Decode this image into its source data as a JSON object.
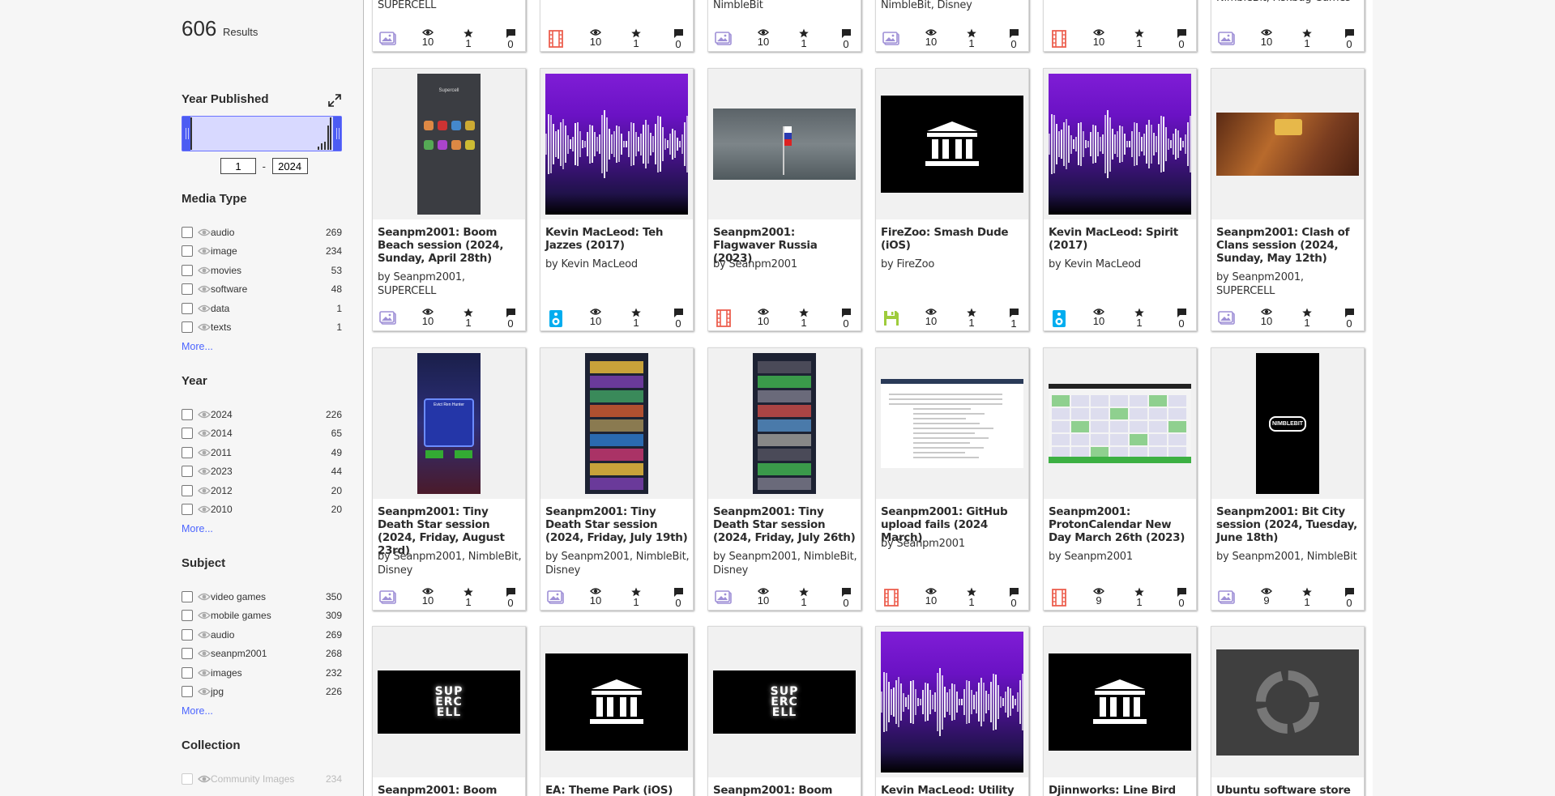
{
  "results": {
    "count": "606",
    "label": "Results"
  },
  "facets": {
    "year_published": {
      "title": "Year Published",
      "from": "1",
      "to": "2024"
    },
    "media_type": {
      "title": "Media Type",
      "items": [
        {
          "label": "audio",
          "count": "269"
        },
        {
          "label": "image",
          "count": "234"
        },
        {
          "label": "movies",
          "count": "53"
        },
        {
          "label": "software",
          "count": "48"
        },
        {
          "label": "data",
          "count": "1"
        },
        {
          "label": "texts",
          "count": "1"
        }
      ],
      "more": "More..."
    },
    "year": {
      "title": "Year",
      "items": [
        {
          "label": "2024",
          "count": "226"
        },
        {
          "label": "2014",
          "count": "65"
        },
        {
          "label": "2011",
          "count": "49"
        },
        {
          "label": "2023",
          "count": "44"
        },
        {
          "label": "2012",
          "count": "20"
        },
        {
          "label": "2010",
          "count": "20"
        }
      ],
      "more": "More..."
    },
    "subject": {
      "title": "Subject",
      "items": [
        {
          "label": "video games",
          "count": "350"
        },
        {
          "label": "mobile games",
          "count": "309"
        },
        {
          "label": "audio",
          "count": "269"
        },
        {
          "label": "seanpm2001",
          "count": "268"
        },
        {
          "label": "images",
          "count": "232"
        },
        {
          "label": "jpg",
          "count": "226"
        }
      ],
      "more": "More..."
    },
    "collection": {
      "title": "Collection",
      "items": [
        {
          "label": "Community Images",
          "count": "234"
        }
      ]
    }
  },
  "top_row": [
    {
      "by": "SUPERCELL",
      "media": "image",
      "views": "10",
      "favs": "1",
      "comments": "0"
    },
    {
      "by": "",
      "media": "movies",
      "views": "10",
      "favs": "1",
      "comments": "0"
    },
    {
      "by": "NimbleBit",
      "media": "image",
      "views": "10",
      "favs": "1",
      "comments": "0"
    },
    {
      "by": "NimbleBit, Disney",
      "media": "image",
      "views": "10",
      "favs": "1",
      "comments": "0"
    },
    {
      "by": "",
      "media": "movies",
      "views": "10",
      "favs": "1",
      "comments": "0"
    },
    {
      "by": "NimbleBit, Fiskbug Games",
      "media": "image",
      "views": "10",
      "favs": "1",
      "comments": "0"
    }
  ],
  "row1": [
    {
      "title": "Seanpm2001: Boom Beach session (2024, Sunday, April 28th)",
      "by": "by Seanpm2001, SUPERCELL",
      "media": "image",
      "views": "10",
      "favs": "1",
      "comments": "0",
      "thumb": "phone"
    },
    {
      "title": "Kevin MacLeod: Teh Jazzes (2017)",
      "by": "by Kevin MacLeod",
      "media": "audio",
      "views": "10",
      "favs": "1",
      "comments": "0",
      "thumb": "wave"
    },
    {
      "title": "Seanpm2001: Flagwaver Russia (2023)",
      "by": "by Seanpm2001",
      "media": "movies",
      "views": "10",
      "favs": "1",
      "comments": "0",
      "thumb": "russia"
    },
    {
      "title": "FireZoo: Smash Dude (iOS)",
      "by": "by FireZoo",
      "media": "software",
      "views": "10",
      "favs": "1",
      "comments": "1",
      "thumb": "archive"
    },
    {
      "title": "Kevin MacLeod: Spirit (2017)",
      "by": "by Kevin MacLeod",
      "media": "audio",
      "views": "10",
      "favs": "1",
      "comments": "0",
      "thumb": "wave"
    },
    {
      "title": "Seanpm2001: Clash of Clans session (2024, Sunday, May 12th)",
      "by": "by Seanpm2001, SUPERCELL",
      "media": "image",
      "views": "10",
      "favs": "1",
      "comments": "0",
      "thumb": "clash"
    }
  ],
  "row2": [
    {
      "title": "Seanpm2001: Tiny Death Star session (2024, Friday, August 23rd)",
      "by": "by Seanpm2001, NimbleBit, Disney",
      "media": "image",
      "views": "10",
      "favs": "1",
      "comments": "0",
      "thumb": "game-blue"
    },
    {
      "title": "Seanpm2001: Tiny Death Star session (2024, Friday, July 19th)",
      "by": "by Seanpm2001, NimbleBit, Disney",
      "media": "image",
      "views": "10",
      "favs": "1",
      "comments": "0",
      "thumb": "game-tower"
    },
    {
      "title": "Seanpm2001: Tiny Death Star session (2024, Friday, July 26th)",
      "by": "by Seanpm2001, NimbleBit, Disney",
      "media": "image",
      "views": "10",
      "favs": "1",
      "comments": "0",
      "thumb": "game-tower2"
    },
    {
      "title": "Seanpm2001: GitHub upload fails (2024 March)",
      "by": "by Seanpm2001",
      "media": "movies",
      "views": "10",
      "favs": "1",
      "comments": "0",
      "thumb": "screenshot"
    },
    {
      "title": "Seanpm2001: ProtonCalendar New Day March 26th (2023)",
      "by": "by Seanpm2001",
      "media": "movies",
      "views": "9",
      "favs": "1",
      "comments": "0",
      "thumb": "calendar"
    },
    {
      "title": "Seanpm2001: Bit City session (2024, Tuesday, June 18th)",
      "by": "by Seanpm2001, NimbleBit",
      "media": "image",
      "views": "9",
      "favs": "1",
      "comments": "0",
      "thumb": "bitcity"
    }
  ],
  "row3": [
    {
      "title": "Seanpm2001: Boom",
      "thumb": "supercell"
    },
    {
      "title": "EA: Theme Park (iOS)",
      "thumb": "archive"
    },
    {
      "title": "Seanpm2001: Boom",
      "thumb": "supercell"
    },
    {
      "title": "Kevin MacLeod: Utility",
      "thumb": "wave"
    },
    {
      "title": "Djinnworks: Line Bird",
      "thumb": "archive"
    },
    {
      "title": "Ubuntu software store",
      "thumb": "loader"
    }
  ],
  "thumb_text": {
    "supercell_header": "Supercell",
    "supercell_logo": [
      "SUP",
      "ERC",
      "ELL"
    ],
    "nimblebit_logo": "NIMBLEBIT",
    "dialog_title": "Evict Ren Hunter"
  },
  "colors": {
    "accent": "#4b64ff",
    "image_icon": "#9e8fd6",
    "movies_icon": "#ec5f4f",
    "audio_icon": "#00adef",
    "software_icon": "#9ecc3c",
    "histogram_fill": "#d8d9ff",
    "histogram_handle": "#4c5cf2"
  }
}
